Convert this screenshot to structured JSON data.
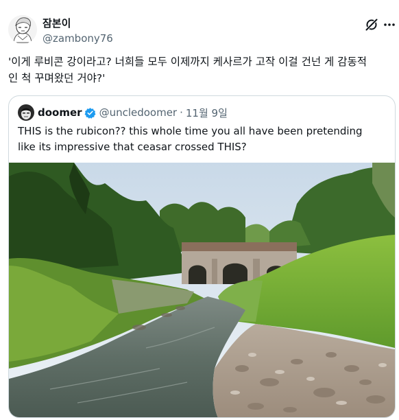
{
  "tweet": {
    "display_name": "잠본이",
    "handle": "@zambony76",
    "text": "'이게 루비콘 강이라고? 너희들 모두 이제까지 케사르가 고작 이걸 건넌 게 감동적\n인 척 꾸며왔던 거야?'",
    "avatar_icon": "anime-character-sketch-avatar"
  },
  "actions": {
    "grok_icon": "grok-slash-icon",
    "more_icon": "more-dots-icon"
  },
  "quote": {
    "display_name": "doomer",
    "verified": true,
    "handle": "@uncledoomer",
    "separator": "·",
    "date": "11월 9일",
    "text": "THIS is the rubicon?? this whole time you all have been pretending like its impressive that ceasar crossed THIS?",
    "avatar_icon": "doomer-avatar",
    "image": "photo of a small shallow rocky stream flowing under a stone arch bridge, with grassy banks and trees"
  },
  "colors": {
    "text": "#0f1419",
    "secondary": "#536471",
    "border": "#cfd9de",
    "verified": "#1d9bf0"
  }
}
